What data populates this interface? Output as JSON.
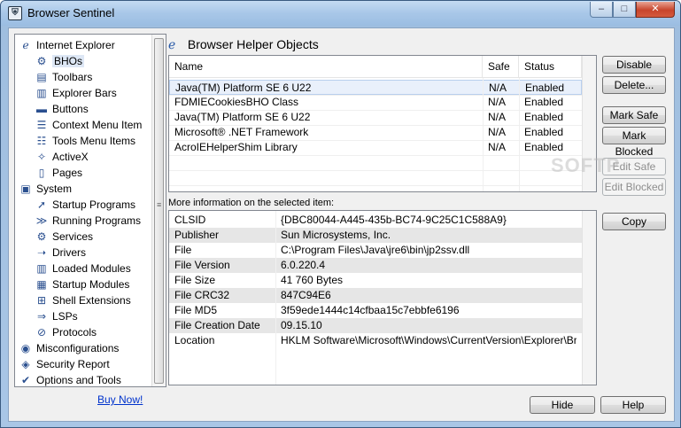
{
  "window": {
    "title": "Browser Sentinel",
    "icon": "shield-app-icon",
    "controls": {
      "minimize": "–",
      "maximize": "□",
      "close": "✕"
    }
  },
  "tree": {
    "items": [
      {
        "label": "Internet Explorer",
        "icon": "ie-icon",
        "level": 0
      },
      {
        "label": "BHOs",
        "icon": "plugin-icon",
        "level": 1,
        "selected": true
      },
      {
        "label": "Toolbars",
        "icon": "toolbar-icon",
        "level": 1
      },
      {
        "label": "Explorer Bars",
        "icon": "explorer-bar-icon",
        "level": 1
      },
      {
        "label": "Buttons",
        "icon": "button-icon",
        "level": 1
      },
      {
        "label": "Context Menu Item",
        "icon": "context-menu-icon",
        "level": 1
      },
      {
        "label": "Tools Menu Items",
        "icon": "tools-menu-icon",
        "level": 1
      },
      {
        "label": "ActiveX",
        "icon": "activex-icon",
        "level": 1
      },
      {
        "label": "Pages",
        "icon": "page-icon",
        "level": 1
      },
      {
        "label": "System",
        "icon": "system-icon",
        "level": 0
      },
      {
        "label": "Startup Programs",
        "icon": "startup-icon",
        "level": 1
      },
      {
        "label": "Running Programs",
        "icon": "running-icon",
        "level": 1
      },
      {
        "label": "Services",
        "icon": "services-icon",
        "level": 1
      },
      {
        "label": "Drivers",
        "icon": "drivers-icon",
        "level": 1
      },
      {
        "label": "Loaded Modules",
        "icon": "modules-icon",
        "level": 1
      },
      {
        "label": "Startup Modules",
        "icon": "startup-modules-icon",
        "level": 1
      },
      {
        "label": "Shell Extensions",
        "icon": "shell-ext-icon",
        "level": 1
      },
      {
        "label": "LSPs",
        "icon": "lsp-icon",
        "level": 1
      },
      {
        "label": "Protocols",
        "icon": "protocols-icon",
        "level": 1
      },
      {
        "label": "Misconfigurations",
        "icon": "misconfig-icon",
        "level": 0
      },
      {
        "label": "Security Report",
        "icon": "report-icon",
        "level": 0
      },
      {
        "label": "Options and Tools",
        "icon": "options-icon",
        "level": 0
      }
    ]
  },
  "buy_now": "Buy Now!",
  "section": {
    "title": "Browser Helper Objects",
    "icon": "ie-icon"
  },
  "list": {
    "columns": [
      "Name",
      "Safe",
      "Status"
    ],
    "rows": [
      {
        "name": "Java(TM) Platform SE 6 U22",
        "safe": "N/A",
        "status": "Enabled",
        "selected": true
      },
      {
        "name": "FDMIECookiesBHO Class",
        "safe": "N/A",
        "status": "Enabled"
      },
      {
        "name": "Java(TM) Platform SE 6 U22",
        "safe": "N/A",
        "status": "Enabled"
      },
      {
        "name": "Microsoft® .NET Framework",
        "safe": "N/A",
        "status": "Enabled"
      },
      {
        "name": "AcroIEHelperShim Library",
        "safe": "N/A",
        "status": "Enabled"
      }
    ]
  },
  "buttons": {
    "disable": "Disable",
    "delete": "Delete...",
    "mark_safe": "Mark Safe",
    "mark_blocked": "Mark Blocked",
    "edit_safe": "Edit Safe",
    "edit_blocked": "Edit Blocked",
    "copy": "Copy",
    "hide": "Hide",
    "help": "Help"
  },
  "info": {
    "label": "More information on the selected item:",
    "rows": [
      {
        "key": "CLSID",
        "value": "{DBC80044-A445-435b-BC74-9C25C1C588A9}"
      },
      {
        "key": "Publisher",
        "value": "Sun Microsystems, Inc."
      },
      {
        "key": "File",
        "value": "C:\\Program Files\\Java\\jre6\\bin\\jp2ssv.dll"
      },
      {
        "key": "File Version",
        "value": "6.0.220.4"
      },
      {
        "key": "File Size",
        "value": "41 760 Bytes"
      },
      {
        "key": "File CRC32",
        "value": "847C94E6"
      },
      {
        "key": "File MD5",
        "value": "3f59ede1444c14cfbaa15c7ebbfe6196"
      },
      {
        "key": "File Creation Date",
        "value": "09.15.10"
      },
      {
        "key": "Location",
        "value": "HKLM Software\\Microsoft\\Windows\\CurrentVersion\\Explorer\\Brow..."
      }
    ]
  },
  "watermark": "SOFTP"
}
